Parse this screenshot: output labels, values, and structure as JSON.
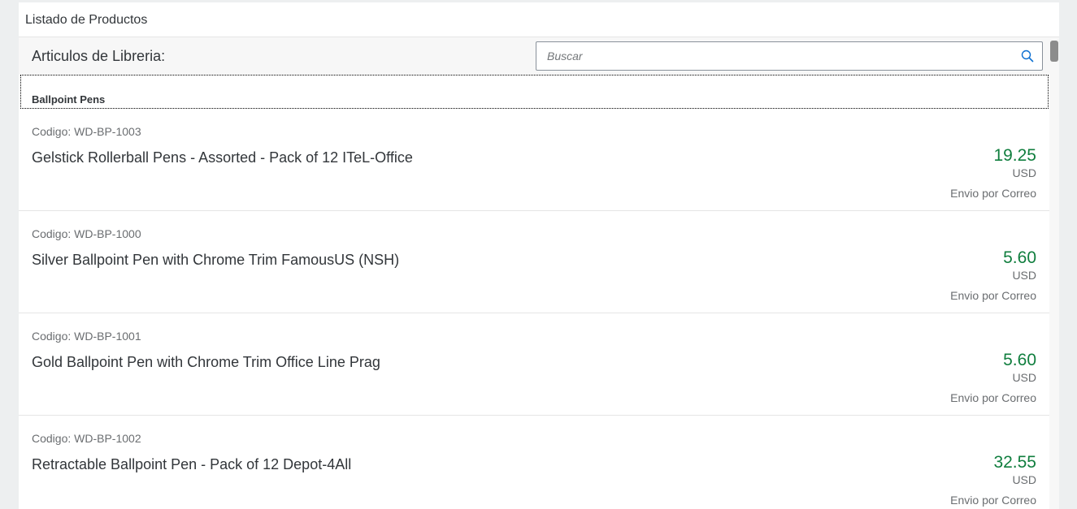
{
  "page": {
    "title": "Listado de Productos"
  },
  "toolbar": {
    "title": "Articulos de Libreria:",
    "search_placeholder": "Buscar",
    "search_value": ""
  },
  "group": {
    "title": "Ballpoint Pens"
  },
  "products": [
    {
      "code": "Codigo: WD-BP-1003",
      "name": "Gelstick Rollerball Pens - Assorted - Pack of 12 ITeL-Office",
      "price": "19.25",
      "currency": "USD",
      "shipping": "Envio por Correo"
    },
    {
      "code": "Codigo: WD-BP-1000",
      "name": "Silver Ballpoint Pen with Chrome Trim FamousUS (NSH)",
      "price": "5.60",
      "currency": "USD",
      "shipping": "Envio por Correo"
    },
    {
      "code": "Codigo: WD-BP-1001",
      "name": "Gold Ballpoint Pen with Chrome Trim Office Line Prag",
      "price": "5.60",
      "currency": "USD",
      "shipping": "Envio por Correo"
    },
    {
      "code": "Codigo: WD-BP-1002",
      "name": "Retractable Ballpoint Pen - Pack of 12 Depot-4All",
      "price": "32.55",
      "currency": "USD",
      "shipping": "Envio por Correo"
    }
  ],
  "colors": {
    "background": "#edeff0",
    "price": "#107e3e",
    "text": "#32363a",
    "secondary_text": "#6a6d70"
  },
  "icons": {
    "search": "search-icon"
  }
}
